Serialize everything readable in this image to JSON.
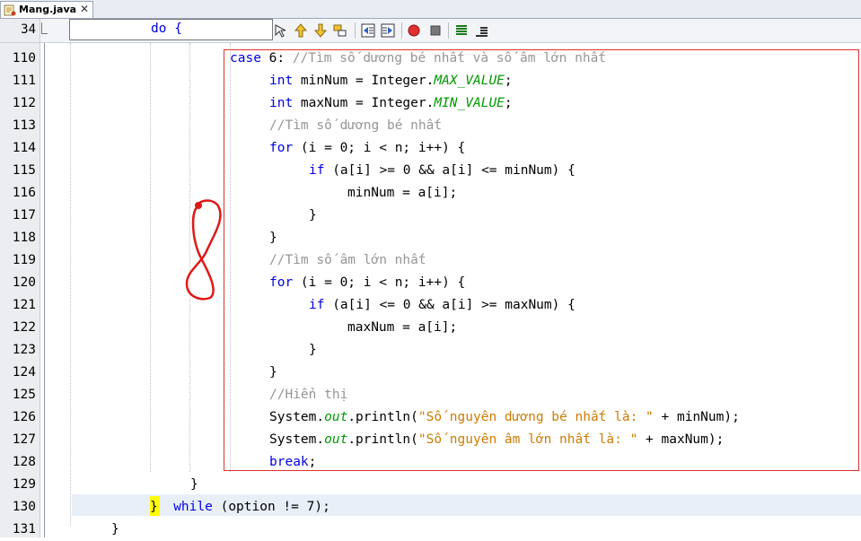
{
  "editor_tab": {
    "file_name": "Mang.java",
    "close": "✕"
  },
  "toolbar": {
    "line_number": "34",
    "code_snippet": "do {",
    "icons": [
      "toggle-comment-icon",
      "find-previous-icon",
      "find-next-icon",
      "find-selection-icon",
      "shift-left-icon",
      "shift-right-icon",
      "start-macro-icon",
      "stop-macro-icon",
      "previous-bookmark-icon",
      "next-bookmark-icon"
    ]
  },
  "gutter": {
    "line_numbers": [
      "110",
      "111",
      "112",
      "113",
      "114",
      "115",
      "116",
      "117",
      "118",
      "119",
      "120",
      "121",
      "122",
      "123",
      "124",
      "125",
      "126",
      "127",
      "128",
      "129",
      "130",
      "131"
    ]
  },
  "code": {
    "l110": {
      "kw": "case",
      "rest": " 6: ",
      "comment": "//Tìm số dương bé nhất và số âm lớn nhất"
    },
    "l111": {
      "kw": "int",
      "a": " minNum = Integer.",
      "field": "MAX_VALUE",
      "b": ";"
    },
    "l112": {
      "kw": "int",
      "a": " maxNum = Integer.",
      "field": "MIN_VALUE",
      "b": ";"
    },
    "l113": {
      "comment": "//Tìm số dương bé nhất"
    },
    "l114": {
      "kw": "for",
      "rest": " (i = 0; i < n; i++) {"
    },
    "l115": {
      "kw": "if",
      "rest": " (a[i] >= 0 && a[i] <= minNum) {"
    },
    "l116": {
      "rest": "minNum = a[i];"
    },
    "l117": {
      "rest": "}"
    },
    "l118": {
      "rest": "}"
    },
    "l119": {
      "comment": "//Tìm số âm lớn nhất"
    },
    "l120": {
      "kw": "for",
      "rest": " (i = 0; i < n; i++) {"
    },
    "l121": {
      "kw": "if",
      "rest": " (a[i] <= 0 && a[i] >= maxNum) {"
    },
    "l122": {
      "rest": "maxNum = a[i];"
    },
    "l123": {
      "rest": "}"
    },
    "l124": {
      "rest": "}"
    },
    "l125": {
      "comment": "//Hiển thị"
    },
    "l126": {
      "a": "System.",
      "field": "out",
      "b": ".println(",
      "str": "\"Số nguyên dương bé nhất là: \"",
      "c": " + minNum);"
    },
    "l127": {
      "a": "System.",
      "field": "out",
      "b": ".println(",
      "str": "\"Số nguyên âm lớn nhất là: \"",
      "c": " + maxNum);"
    },
    "l128": {
      "kw": "break",
      "rest": ";"
    },
    "l129": {
      "rest": "}"
    },
    "l130": {
      "brace": "}",
      "kw": "while",
      "rest": " (option != 7);"
    },
    "l131": {
      "rest": "}"
    }
  },
  "colors": {
    "keyword": "#0000e6",
    "comment": "#969696",
    "string": "#ce7b00",
    "field": "#009900",
    "annotation_box": "#e03030",
    "current_line": "#e9eff8",
    "bracket_match": "#ffff00"
  }
}
